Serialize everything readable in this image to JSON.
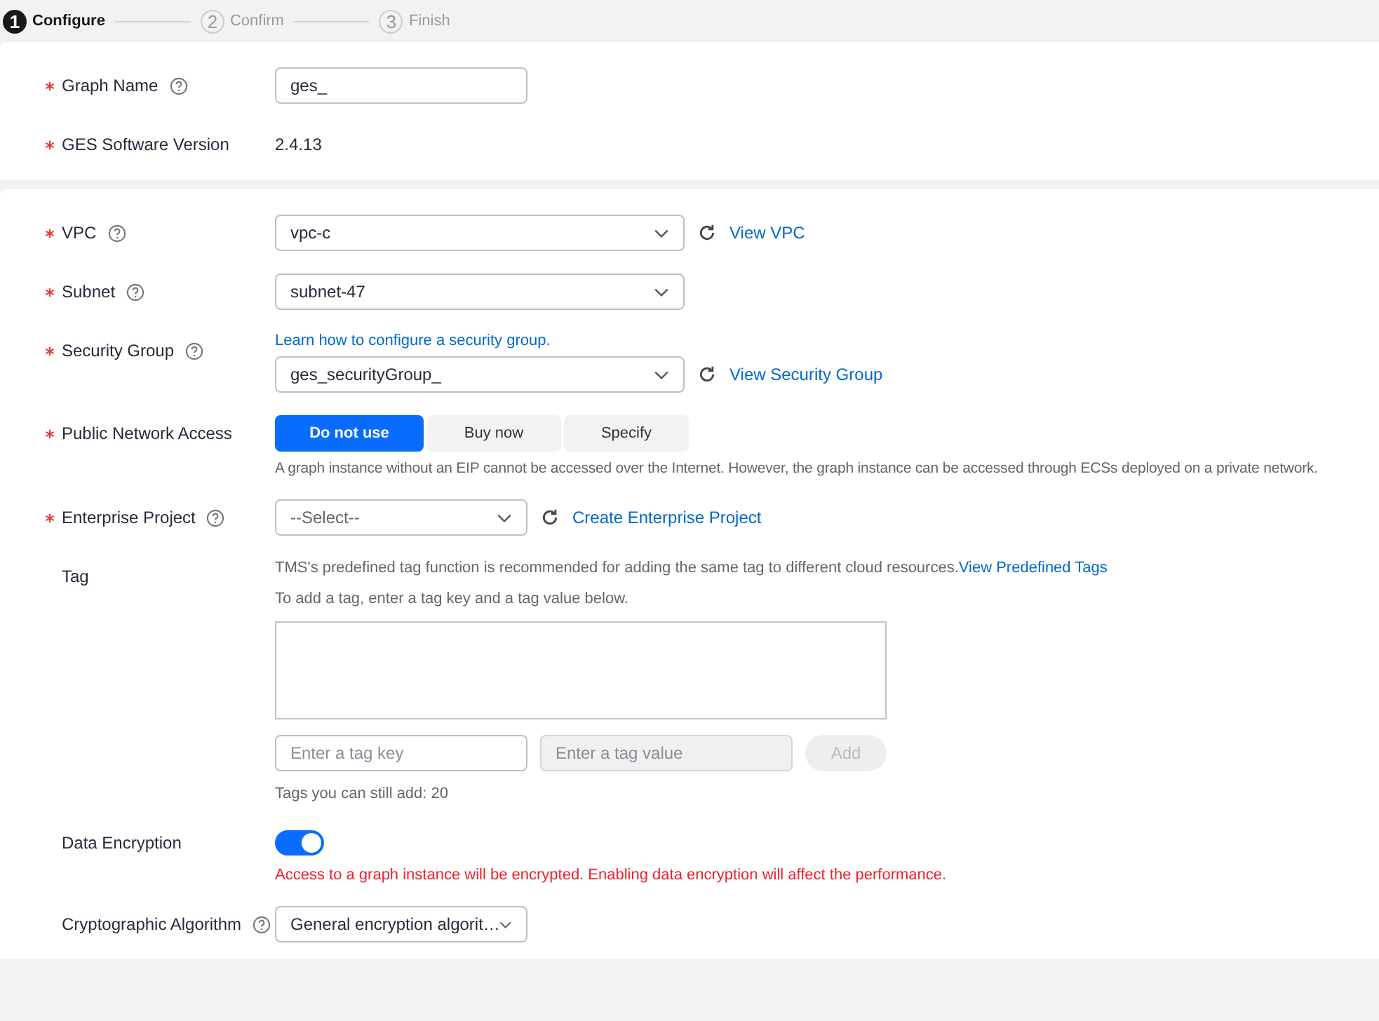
{
  "steps": [
    {
      "number": "1",
      "label": "Configure",
      "selected": true
    },
    {
      "number": "2",
      "label": "Confirm",
      "selected": false
    },
    {
      "number": "3",
      "label": "Finish",
      "selected": false
    }
  ],
  "sections": [
    {
      "fields": [
        {
          "kind": "input",
          "label": "Graph Name",
          "required": true,
          "help": true,
          "value": "ges_"
        },
        {
          "kind": "text",
          "label": "GES Software Version",
          "required": true,
          "help": false,
          "value": "2.4.13"
        }
      ]
    },
    {
      "fields": [
        {
          "kind": "select",
          "label": "VPC",
          "required": true,
          "help": true,
          "value": "vpc-c",
          "action": "View VPC"
        },
        {
          "kind": "select",
          "label": "Subnet",
          "required": true,
          "help": true,
          "value": "subnet-47"
        },
        {
          "kind": "select",
          "label": "Security Group",
          "required": true,
          "help": true,
          "link": "Learn how to configure a security group.",
          "value": "ges_securityGroup_",
          "action": "View Security Group"
        },
        {
          "kind": "segmented",
          "label": "Public Network Access",
          "required": true,
          "help": false,
          "options": [
            {
              "label": "Do not use",
              "selected": true
            },
            {
              "label": "Buy now",
              "selected": false
            },
            {
              "label": "Specify",
              "selected": false
            }
          ],
          "hint": "A graph instance without an EIP cannot be accessed over the Internet. However, the graph instance can be accessed through ECSs deployed on a private network."
        },
        {
          "kind": "compact-select",
          "label": "Enterprise Project",
          "required": true,
          "help": true,
          "placeholder": "--Select--",
          "action": "Create Enterprise Project"
        },
        {
          "kind": "tags",
          "label": "Tag",
          "required": false,
          "help": false,
          "intro": "TMS's predefined tag function is recommended for adding the same tag to different cloud resources.",
          "intro_link": "View Predefined Tags",
          "note": "To add a tag, enter a tag key and a tag value below.",
          "key_placeholder": "Enter a tag key",
          "value_placeholder": "Enter a tag value",
          "value_disabled": true,
          "add_label": "Add",
          "add_disabled": true,
          "count": "Tags you can still add: 20"
        },
        {
          "kind": "toggle",
          "label": "Data Encryption",
          "required": false,
          "help": false,
          "on": true,
          "warning": "Access to a graph instance will be encrypted. Enabling data encryption will affect the performance."
        },
        {
          "kind": "compact-select",
          "label": "Cryptographic Algorithm",
          "required": false,
          "help": true,
          "value": "General encryption algorit…"
        }
      ]
    }
  ]
}
